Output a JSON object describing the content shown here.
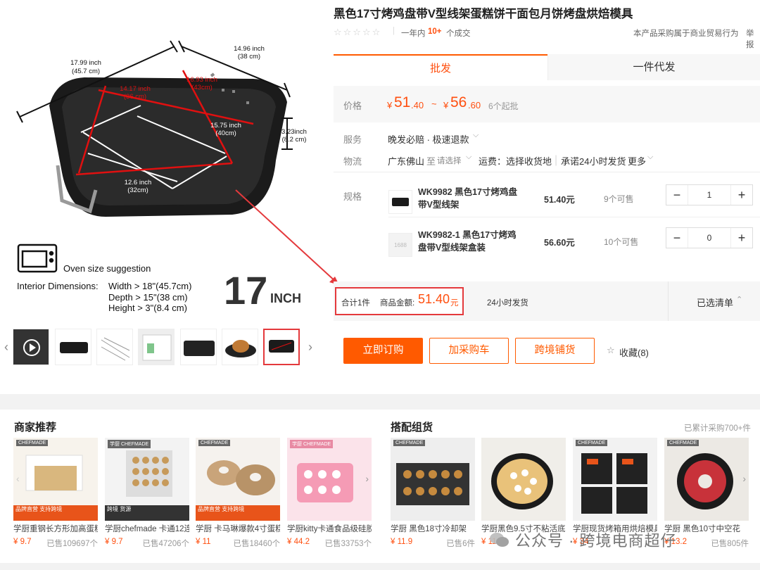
{
  "product": {
    "title": "黑色17寸烤鸡盘带V型线架蛋糕饼干面包月饼烤盘烘焙模具",
    "sales_prefix": "一年内",
    "sales_count": "10+",
    "sales_suffix": "个成交",
    "notice": "本产品采购属于商业贸易行为",
    "report": "举报"
  },
  "image_annotations": {
    "outer_length": "17.99 inch",
    "outer_length_cm": "(45.7 cm)",
    "outer_width": "14.96 inch",
    "outer_width_cm": "(38 cm)",
    "inner_length": "14.17 inch",
    "inner_length_cm": "(36 cm)",
    "inner_width": "16.93 inch",
    "inner_width_cm": "(43cm)",
    "rack_length": "15.75 inch",
    "rack_length_cm": "(40cm)",
    "rack_width": "12.6 inch",
    "rack_width_cm": "(32cm)",
    "height": "3.23inch",
    "height_cm": "(8.2 cm)",
    "oven_title": "Oven size suggestion",
    "interior_label": "Interior Dimensions:",
    "width_req": "Width > 18\"(45.7cm)",
    "depth_req": "Depth > 15\"(38 cm)",
    "height_req": "Height > 3\"(8.4 cm)",
    "size_big": "17",
    "size_unit": "INCH"
  },
  "tabs": [
    "批发",
    "一件代发"
  ],
  "price": {
    "label": "价格",
    "currency": "¥",
    "low_int": "51",
    "low_dec": ".40",
    "sep": "~",
    "high_int": "56",
    "high_dec": ".60",
    "moq": "6个起批"
  },
  "service": {
    "label": "服务",
    "value": "晚发必赔 · 极速退款"
  },
  "logistics": {
    "label": "物流",
    "origin": "广东佛山",
    "to": "至",
    "select": "请选择",
    "fee": "运费：选择收货地",
    "promise": "承诺24小时发货",
    "more": "更多"
  },
  "specs": {
    "label": "规格",
    "items": [
      {
        "name": "WK9982 黑色17寸烤鸡盘带V型线架",
        "price": "51.40元",
        "stock": "9个可售",
        "qty": "1"
      },
      {
        "name": "WK9982-1 黑色17寸烤鸡盘带V型线架盒装",
        "price": "56.60元",
        "stock": "10个可售",
        "qty": "0",
        "thumb_text": "1688"
      }
    ]
  },
  "summary": {
    "count": "合计1件",
    "amount_label": "商品金额:",
    "amount": "51.40",
    "amount_unit": "元",
    "ship": "24小时发货",
    "selected": "已选清单"
  },
  "actions": {
    "buy": "立即订购",
    "cart": "加采购车",
    "cross": "跨境铺货",
    "fav": "收藏(8)"
  },
  "merchant": {
    "title": "商家推荐",
    "items": [
      {
        "name": "学厨重钢长方形加高蛋糕",
        "price": "¥ 9.7",
        "sold": "已售109697个",
        "brand": "CHEFMADE",
        "badge": "品牌直营 支持跨境"
      },
      {
        "name": "学厨chefmade 卡通12连",
        "price": "¥ 9.7",
        "sold": "已售47206个",
        "brand": "学厨 CHEFMADE",
        "badge": "跨境 货源"
      },
      {
        "name": "学厨 卡马琳爆款4寸蛋糕",
        "price": "¥ 11",
        "sold": "已售18460个",
        "brand": "CHEFMADE",
        "badge": "品牌直营 支持跨境"
      },
      {
        "name": "学厨kitty卡通食品级硅胶",
        "price": "¥ 44.2",
        "sold": "已售33753个",
        "brand": "学厨 CHEFMADE",
        "badge": ""
      }
    ]
  },
  "combo": {
    "title": "搭配组货",
    "purchased": "已累计采购700+件",
    "items": [
      {
        "name": "学厨 黑色18寸冷却架",
        "price": "¥ 11.9",
        "sold": "已售6件",
        "brand": "CHEFMADE"
      },
      {
        "name": "学厨黑色9.5寸不粘活底",
        "price": "¥ 11",
        "sold": "",
        "brand": ""
      },
      {
        "name": "学厨现货烤箱用烘焙模具",
        "price": "¥ 34",
        "sold": "",
        "brand": "CHEFMADE"
      },
      {
        "name": "学厨 黑色10寸中空花",
        "price": "¥ 13.2",
        "sold": "已售805件",
        "brand": "CHEFMADE"
      }
    ]
  },
  "watermark": "公众号 · 跨境电商超仔",
  "colors": {
    "accent": "#ff5a00",
    "highlight": "#e4393c",
    "price": "#ff4f0f"
  }
}
